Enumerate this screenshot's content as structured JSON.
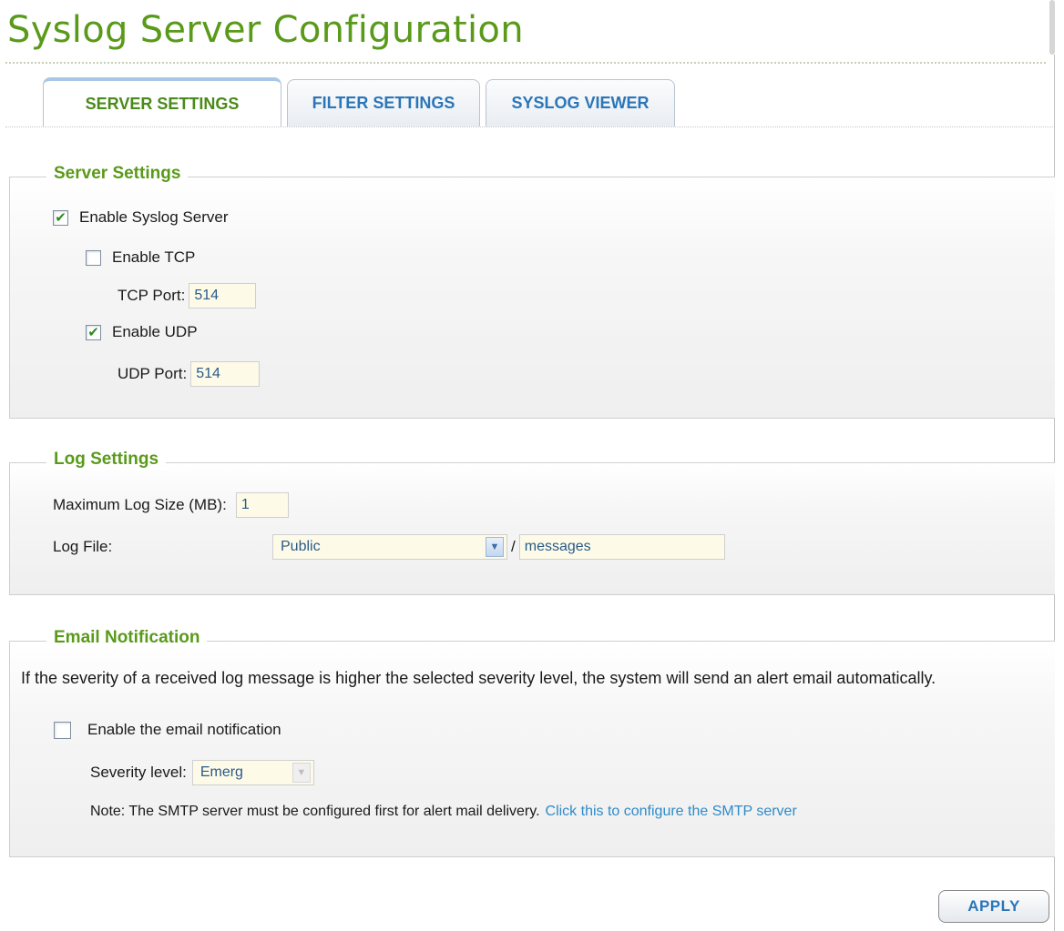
{
  "page": {
    "title": "Syslog Server Configuration"
  },
  "tabs": [
    {
      "label": "SERVER SETTINGS",
      "active": true
    },
    {
      "label": "FILTER SETTINGS",
      "active": false
    },
    {
      "label": "SYSLOG VIEWER",
      "active": false
    }
  ],
  "server_settings": {
    "legend": "Server Settings",
    "enable_syslog": {
      "label": "Enable Syslog Server",
      "checked": true
    },
    "enable_tcp": {
      "label": "Enable TCP",
      "checked": false
    },
    "tcp_port": {
      "label": "TCP Port:",
      "value": "514"
    },
    "enable_udp": {
      "label": "Enable UDP",
      "checked": true
    },
    "udp_port": {
      "label": "UDP Port:",
      "value": "514"
    }
  },
  "log_settings": {
    "legend": "Log Settings",
    "max_size": {
      "label": "Maximum Log Size (MB):",
      "value": "1"
    },
    "log_file": {
      "label": "Log File:",
      "folder": "Public",
      "separator": "/",
      "filename": "messages"
    }
  },
  "email_notification": {
    "legend": "Email Notification",
    "description": "If the severity of a received log message is higher the selected severity level, the system will send an alert email automatically.",
    "enable": {
      "label": "Enable the email notification",
      "checked": false
    },
    "severity": {
      "label": "Severity level:",
      "value": "Emerg"
    },
    "note": "Note: The SMTP server must be configured first for alert mail delivery.",
    "note_link": "Click this to configure the SMTP server"
  },
  "actions": {
    "apply_label": "APPLY"
  },
  "colors": {
    "title_green": "#5a9a1a",
    "tab_blue": "#2b76b8",
    "link_blue": "#2e8bc9",
    "input_bg": "#fdfbe8"
  }
}
